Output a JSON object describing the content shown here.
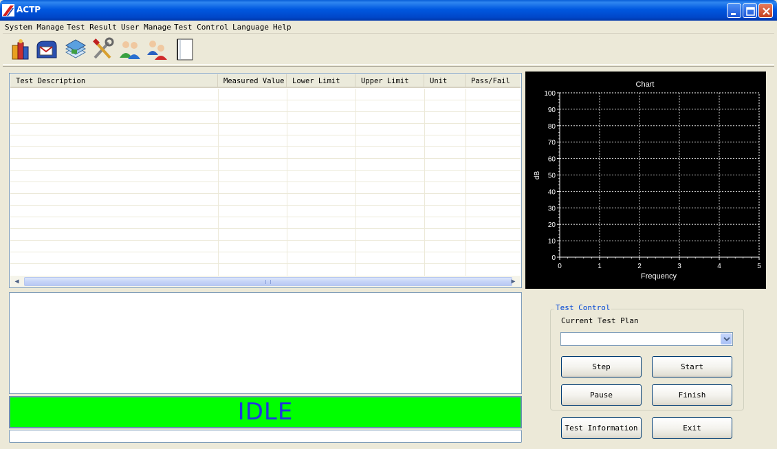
{
  "window": {
    "title": "ACTP"
  },
  "menu": [
    "System Manage",
    "Test Result",
    "User Manage",
    "Test Control",
    "Language",
    "Help"
  ],
  "toolbar": [
    "books-icon",
    "mailbox-icon",
    "database-icon",
    "tools-icon",
    "users-icon",
    "user-manage-icon",
    "document-icon"
  ],
  "table": {
    "columns": [
      "Test Description",
      "Measured Value",
      "Lower Limit",
      "Upper Limit",
      "Unit",
      "Pass/Fail"
    ]
  },
  "chart_data": {
    "type": "line",
    "title": "Chart",
    "xlabel": "Frequency",
    "ylabel": "dB",
    "xlim": [
      0,
      5
    ],
    "ylim": [
      0,
      100
    ],
    "x_ticks": [
      0,
      1,
      2,
      3,
      4,
      5
    ],
    "y_ticks": [
      0,
      10,
      20,
      30,
      40,
      50,
      60,
      70,
      80,
      90,
      100
    ],
    "grid": true,
    "series": [],
    "background": "#000000",
    "foreground": "#ffffff"
  },
  "status": {
    "text": "IDLE",
    "bg_color": "#00ff00",
    "text_color": "#2233e0"
  },
  "test_control": {
    "legend": "Test Control",
    "plan_label": "Current Test Plan",
    "plan_value": "",
    "buttons": {
      "step": "Step",
      "start": "Start",
      "pause": "Pause",
      "finish": "Finish",
      "info": "Test Information",
      "exit": "Exit"
    }
  }
}
